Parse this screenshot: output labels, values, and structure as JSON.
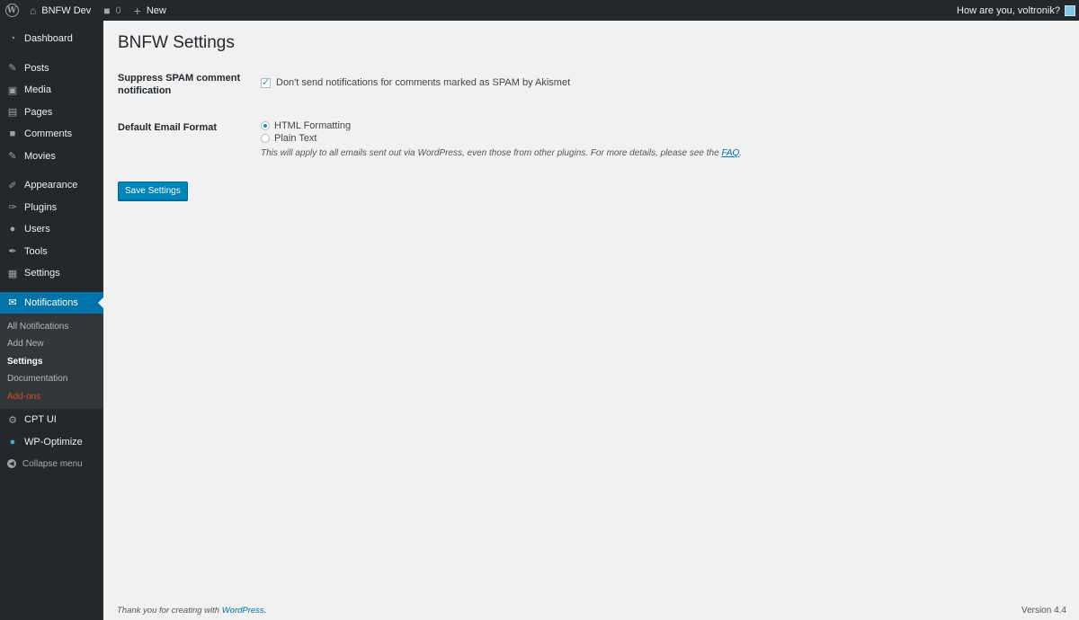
{
  "adminbar": {
    "site_name": "BNFW Dev",
    "comments_count": "0",
    "new_label": "New",
    "greeting": "How are you, voltronik?"
  },
  "sidebar": {
    "items": [
      {
        "label": "Dashboard",
        "icon": "dashboard-icon"
      },
      {
        "label": "Posts",
        "icon": "pin-icon"
      },
      {
        "label": "Media",
        "icon": "media-icon"
      },
      {
        "label": "Pages",
        "icon": "page-icon"
      },
      {
        "label": "Comments",
        "icon": "comment-icon"
      },
      {
        "label": "Movies",
        "icon": "pin-icon"
      },
      {
        "label": "Appearance",
        "icon": "brush-icon"
      },
      {
        "label": "Plugins",
        "icon": "plug-icon"
      },
      {
        "label": "Users",
        "icon": "user-icon"
      },
      {
        "label": "Tools",
        "icon": "wrench-icon"
      },
      {
        "label": "Settings",
        "icon": "settings-icon"
      },
      {
        "label": "Notifications",
        "icon": "envelope-icon"
      },
      {
        "label": "CPT UI",
        "icon": "gear-icon"
      },
      {
        "label": "WP-Optimize",
        "icon": "optimize-icon"
      }
    ],
    "submenu": [
      {
        "label": "All Notifications"
      },
      {
        "label": "Add New"
      },
      {
        "label": "Settings"
      },
      {
        "label": "Documentation"
      },
      {
        "label": "Add-ons"
      }
    ],
    "collapse_label": "Collapse menu"
  },
  "main": {
    "title": "BNFW Settings",
    "spam": {
      "label": "Suppress SPAM comment notification",
      "checkbox_label": "Don't send notifications for comments marked as SPAM by Akismet",
      "checked": true
    },
    "email_format": {
      "label": "Default Email Format",
      "options": [
        "HTML Formatting",
        "Plain Text"
      ],
      "selected": "HTML Formatting",
      "description": "This will apply to all emails sent out via WordPress, even those from other plugins. For more details, please see the",
      "faq_link": "FAQ"
    },
    "save_label": "Save Settings"
  },
  "footer": {
    "thanks_prefix": "Thank you for creating with",
    "wordpress_link": "WordPress",
    "version": "Version 4.4"
  },
  "colors": {
    "accent": "#0073aa",
    "sidebar_bg": "#23282d",
    "addons": "#d54e21"
  }
}
